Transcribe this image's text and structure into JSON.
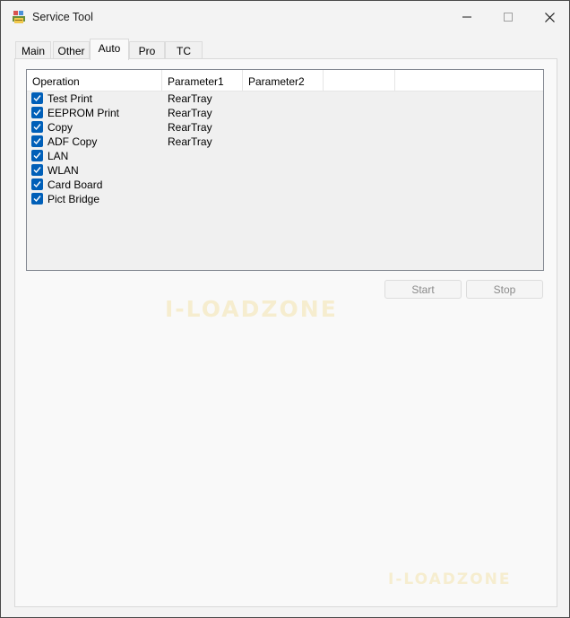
{
  "window": {
    "title": "Service Tool",
    "icon": "app-printer-icon",
    "controls": [
      "minimize-icon",
      "maximize-icon",
      "close-icon"
    ]
  },
  "tabs": [
    {
      "label": "Main",
      "active": false
    },
    {
      "label": "Other",
      "active": false
    },
    {
      "label": "Auto",
      "active": true
    },
    {
      "label": "Pro",
      "active": false
    },
    {
      "label": "TC",
      "active": false
    }
  ],
  "listview": {
    "columns": [
      "Operation",
      "Parameter1",
      "Parameter2",
      "",
      ""
    ],
    "rows": [
      {
        "operation": "Test Print",
        "parameter1": "RearTray",
        "checked": true
      },
      {
        "operation": "EEPROM Print",
        "parameter1": "RearTray",
        "checked": true
      },
      {
        "operation": "Copy",
        "parameter1": "RearTray",
        "checked": true
      },
      {
        "operation": "ADF Copy",
        "parameter1": "RearTray",
        "checked": true
      },
      {
        "operation": "LAN",
        "parameter1": "",
        "checked": true
      },
      {
        "operation": "WLAN",
        "parameter1": "",
        "checked": true
      },
      {
        "operation": "Card Board",
        "parameter1": "",
        "checked": true
      },
      {
        "operation": "Pict Bridge",
        "parameter1": "",
        "checked": true
      }
    ]
  },
  "buttons": {
    "start": "Start",
    "stop": "Stop",
    "disabled": true
  },
  "watermarks": [
    "I-LOADZONE",
    "I-LOADZONE"
  ],
  "colors": {
    "checkbox": "#005fb8",
    "watermark": "#f0d782"
  }
}
